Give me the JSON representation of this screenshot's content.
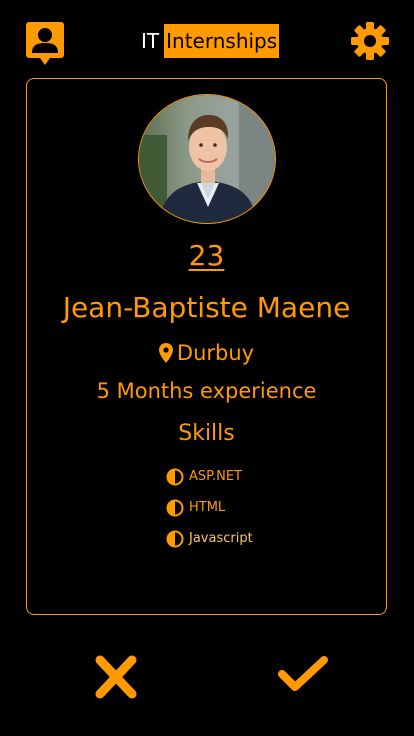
{
  "brand": {
    "prefix": "IT",
    "name": "Internships"
  },
  "header": {
    "profile_icon": "user-profile-icon",
    "settings_icon": "gear-icon"
  },
  "candidate": {
    "age": "23",
    "name": "Jean-Baptiste Maene",
    "location": "Durbuy",
    "location_icon": "map-pin-icon",
    "experience": "5 Months experience",
    "skills_title": "Skills",
    "skills": [
      {
        "name": "ASP.NET",
        "icon": "half-circle-icon"
      },
      {
        "name": "HTML",
        "icon": "half-circle-icon"
      },
      {
        "name": "Javascript",
        "icon": "half-circle-icon"
      }
    ]
  },
  "actions": {
    "dislike_icon": "cross-icon",
    "like_icon": "checkmark-icon"
  },
  "colors": {
    "accent": "#ff9a00",
    "background": "#000000"
  }
}
